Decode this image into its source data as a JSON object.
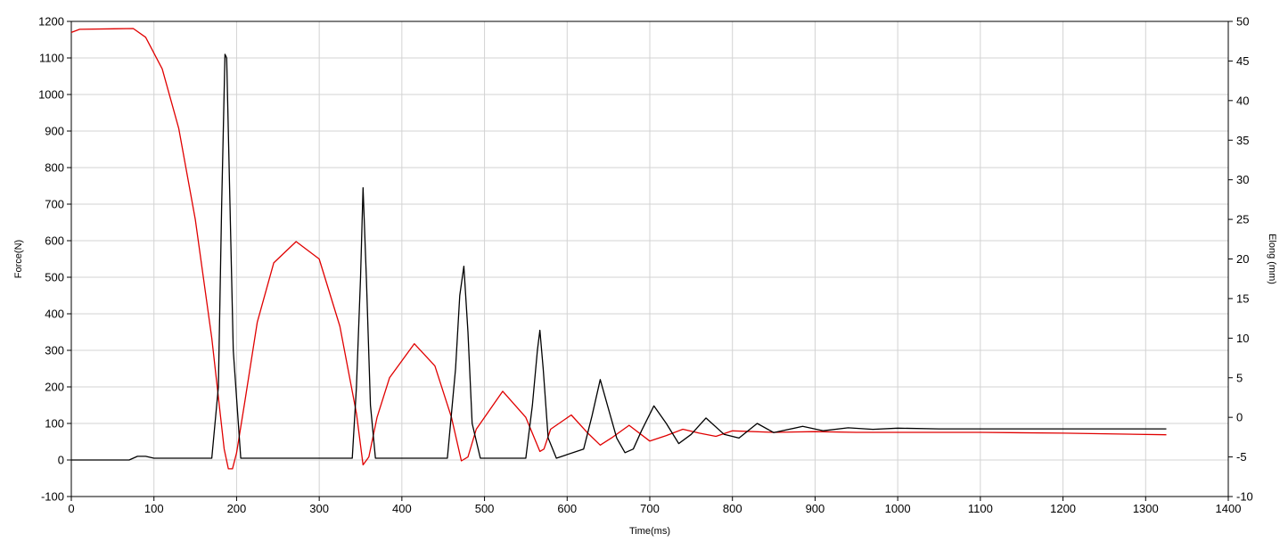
{
  "chart_data": {
    "type": "line",
    "title": "",
    "xlabel": "Time(ms)",
    "ylabel": "Force(N)",
    "y2label": "Elong (mm)",
    "xlim": [
      0,
      1400
    ],
    "ylim": [
      -100,
      1200
    ],
    "y2lim": [
      -10,
      50
    ],
    "grid": true,
    "legend": "none",
    "xticks": [
      "0",
      "100",
      "200",
      "300",
      "400",
      "500",
      "600",
      "700",
      "800",
      "900",
      "1000",
      "1100",
      "1200",
      "1300",
      "1400"
    ],
    "yticks": [
      "-100",
      "0",
      "100",
      "200",
      "300",
      "400",
      "500",
      "600",
      "700",
      "800",
      "900",
      "1000",
      "1100",
      "1200"
    ],
    "y2ticks": [
      "-10",
      "-5",
      "0",
      "5",
      "10",
      "15",
      "20",
      "25",
      "30",
      "35",
      "40",
      "45",
      "50"
    ],
    "series": [
      {
        "axis": "left",
        "color": "#000000",
        "x": [
          0,
          70,
          80,
          90,
          100,
          170,
          178,
          182,
          186,
          188,
          192,
          196,
          205,
          340,
          345,
          350,
          353,
          357,
          362,
          368,
          375,
          455,
          465,
          470,
          475,
          480,
          485,
          495,
          550,
          558,
          564,
          567,
          571,
          577,
          587,
          620,
          630,
          640,
          650,
          660,
          670,
          680,
          690,
          705,
          720,
          735,
          750,
          768,
          790,
          808,
          830,
          850,
          885,
          910,
          940,
          970,
          1000,
          1050,
          1100,
          1200,
          1325
        ],
        "y": [
          0,
          0,
          10,
          10,
          5,
          5,
          200,
          700,
          1110,
          1100,
          700,
          300,
          5,
          5,
          200,
          500,
          745,
          500,
          150,
          5,
          5,
          5,
          250,
          450,
          530,
          350,
          100,
          5,
          5,
          150,
          300,
          355,
          250,
          60,
          5,
          30,
          120,
          220,
          140,
          60,
          20,
          30,
          80,
          148,
          100,
          45,
          70,
          115,
          70,
          60,
          100,
          75,
          92,
          80,
          88,
          84,
          87,
          85,
          85,
          85,
          85
        ]
      },
      {
        "axis": "right",
        "color": "#e00000",
        "x": [
          0,
          10,
          75,
          90,
          110,
          130,
          150,
          170,
          185,
          190,
          195,
          200,
          210,
          225,
          245,
          272,
          300,
          325,
          345,
          353,
          360,
          370,
          385,
          415,
          440,
          460,
          472,
          480,
          490,
          522,
          550,
          567,
          572,
          580,
          605,
          625,
          640,
          655,
          675,
          700,
          720,
          740,
          760,
          780,
          800,
          850,
          900,
          950,
          1000,
          1100,
          1200,
          1325
        ],
        "y": [
          48.6,
          49.0,
          49.1,
          48.0,
          44.0,
          36.5,
          25.0,
          10.0,
          -4.0,
          -6.5,
          -6.5,
          -4.5,
          2.0,
          12.0,
          19.5,
          22.2,
          20.0,
          11.5,
          0.5,
          -6.0,
          -5.0,
          0.0,
          5.0,
          9.3,
          6.5,
          0.0,
          -5.5,
          -5.0,
          -1.5,
          3.3,
          0.0,
          -4.3,
          -4.0,
          -1.5,
          0.3,
          -2.0,
          -3.5,
          -2.5,
          -1.0,
          -3.0,
          -2.3,
          -1.5,
          -2.0,
          -2.4,
          -1.7,
          -1.9,
          -1.8,
          -1.9,
          -1.9,
          -1.9,
          -2.0,
          -2.2
        ]
      }
    ]
  }
}
